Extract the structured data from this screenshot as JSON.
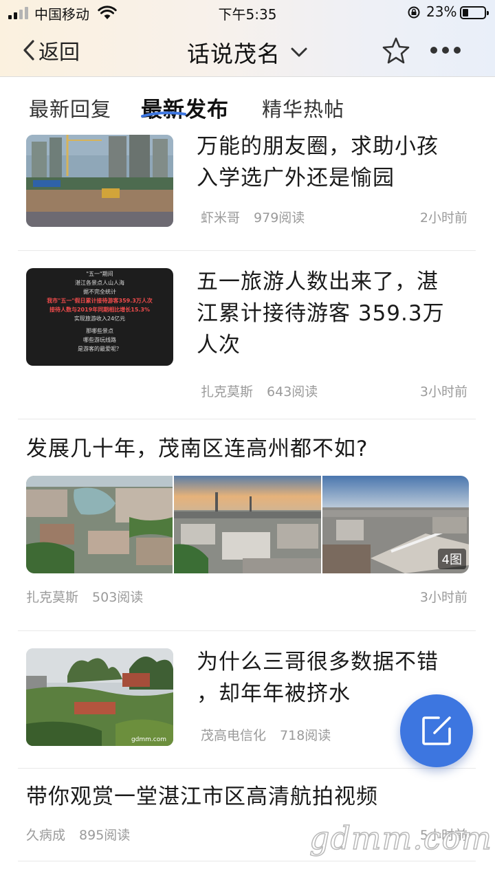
{
  "status_bar": {
    "carrier": "中国移动",
    "time": "下午5:35",
    "battery": "23%"
  },
  "nav": {
    "back_label": "返回",
    "title": "话说茂名"
  },
  "tabs": [
    {
      "label": "最新回复",
      "active": false
    },
    {
      "label": "最新发布",
      "active": true
    },
    {
      "label": "精华热帖",
      "active": false
    }
  ],
  "posts": [
    {
      "title_line1": "万能的朋友圈，求助小孩",
      "title_line2": "入学选广外还是愉园",
      "author": "虾米哥",
      "views": "979阅读",
      "time": "2小时前"
    },
    {
      "title_line1": "五一旅游人数出来了，湛",
      "title_line2": "江累计接待游客 359.3万",
      "title_line3": "人次",
      "author": "扎克莫斯",
      "views": "643阅读",
      "time": "3小时前",
      "thumb_text": {
        "l1": "\"五一\"期间",
        "l2": "湛江各景点人山人海",
        "l3": "据不完全统计",
        "l4": "我市\"五一\"假日累计接待游客359.3万人次",
        "l5": "接待人数与2019年同期相比增长15.3%",
        "l6": "实现旅游收入24亿元",
        "l7": "那哪些景点",
        "l8": "哪些游玩线路",
        "l9": "是游客的最爱呢？"
      }
    },
    {
      "title": "发展几十年，茂南区连高州都不如?",
      "author": "扎克莫斯",
      "views": "503阅读",
      "time": "3小时前",
      "image_count": "4图"
    },
    {
      "title_line1": "为什么三哥很多数据不错",
      "title_line2": "，却年年被挤水",
      "author": "茂高电信化",
      "views": "718阅读",
      "thumb_caption": "gdmm.com"
    },
    {
      "title": "带你观赏一堂湛江市区高清航拍视频",
      "author": "久病成",
      "views": "895阅读",
      "time": "5小时前"
    }
  ],
  "watermark": "gdmm.com",
  "colors": {
    "accent": "#3d76e0",
    "meta": "#9a9a9a",
    "tab_underline": "#3d76e0"
  }
}
